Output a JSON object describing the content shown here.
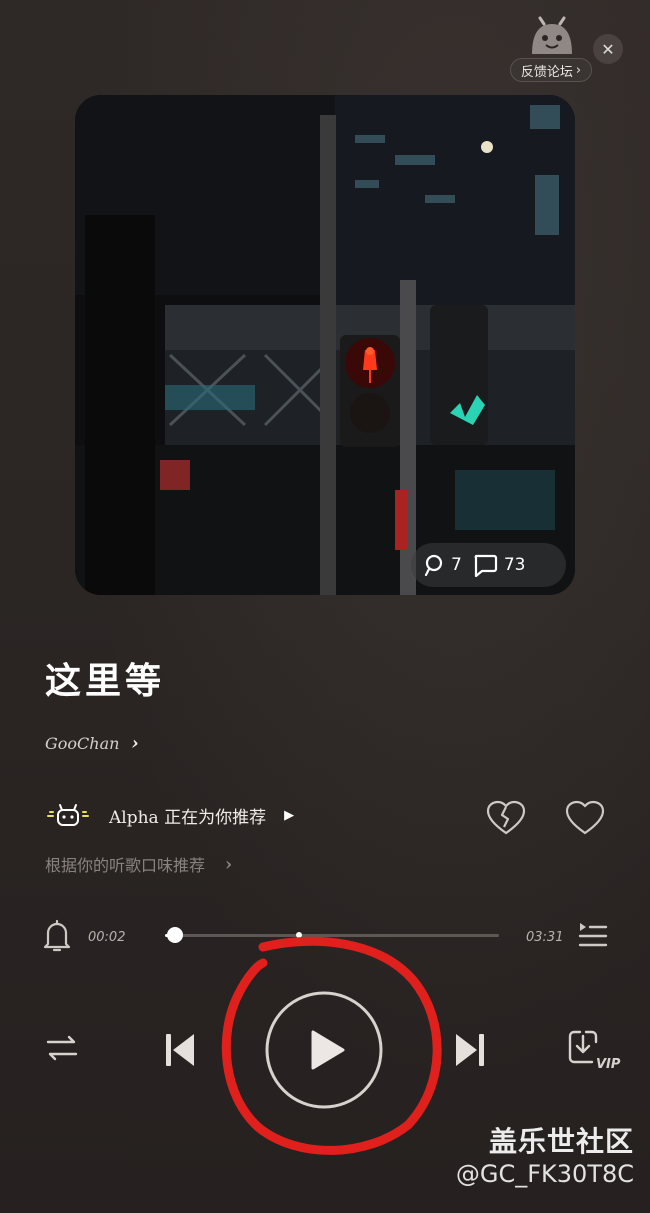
{
  "top": {
    "feedback_label": "反馈论坛",
    "feedback_chevron": "›",
    "close_glyph": "✕"
  },
  "album": {
    "likes_count": "7",
    "comments_count": "73"
  },
  "song": {
    "title": "这里等",
    "artist": "GooChan",
    "artist_chevron": "›"
  },
  "recommend": {
    "alpha_text": "Alpha 正在为你推荐",
    "alpha_play_glyph": "▶",
    "reason_text": "根据你的听歌口味推荐",
    "reason_chevron": "›"
  },
  "player": {
    "current_time": "00:02",
    "total_time": "03:31",
    "progress": 0.03,
    "marker_position": 0.4
  },
  "watermark": {
    "site": "盖乐世社区",
    "user": "@GC_FK30T8C"
  },
  "colors": {
    "background": "#2a2523",
    "annotation_red": "#e0201c",
    "traffic_red": "#ff3a1a",
    "traffic_green": "#2ee8c6"
  }
}
